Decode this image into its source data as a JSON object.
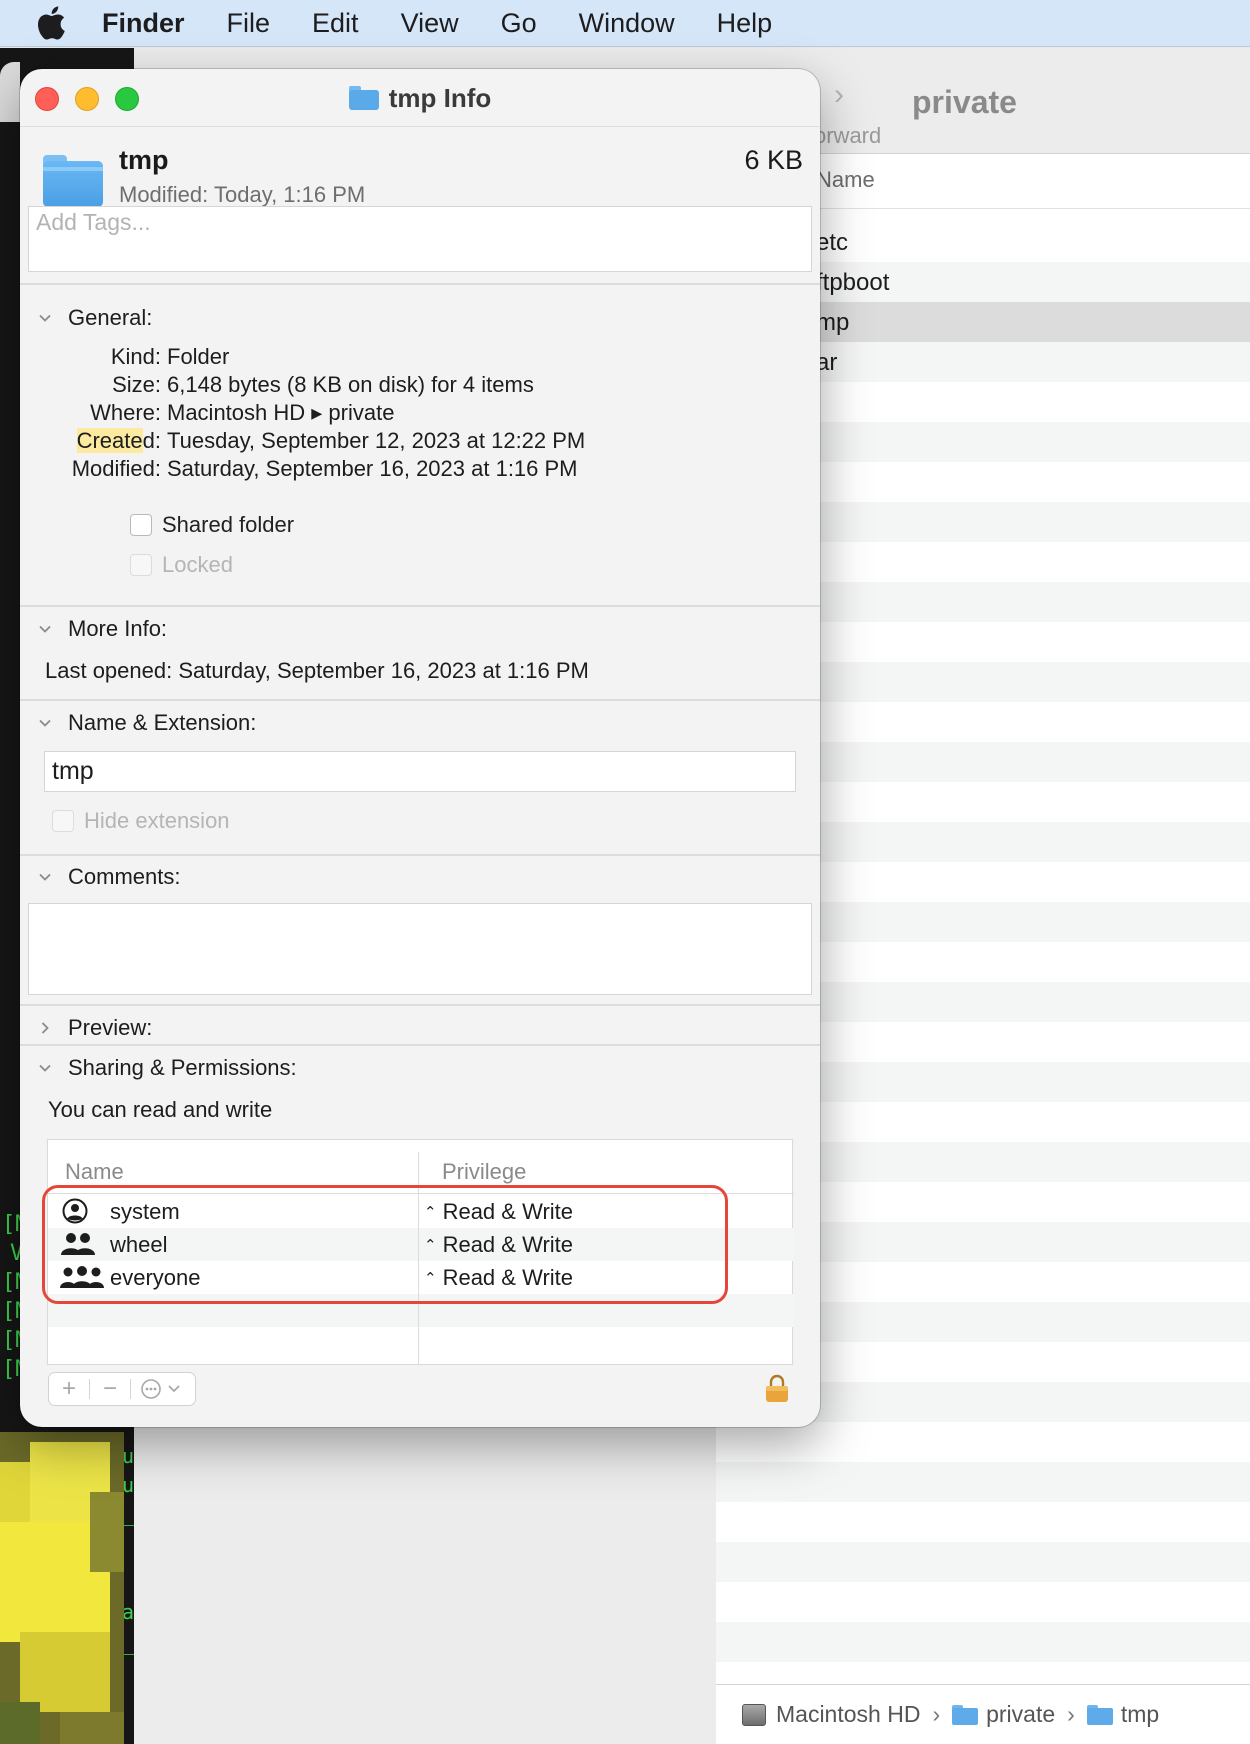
{
  "menubar": {
    "app_name": "Finder",
    "items": [
      "File",
      "Edit",
      "View",
      "Go",
      "Window",
      "Help"
    ]
  },
  "terminal": {
    "lines": [
      "[M",
      "V",
      "[M",
      "[M",
      "[M",
      "[MacBook"
    ],
    "right_chars": [
      "u",
      "u",
      "u",
      "_",
      "a",
      "_"
    ]
  },
  "finder_window": {
    "title": "private",
    "forward_label": "orward",
    "column_header": "Name",
    "rows": [
      "etc",
      "ftpboot",
      "mp",
      "ar"
    ],
    "selected_index": 2,
    "pathbar": [
      "Macintosh HD",
      "private",
      "tmp"
    ]
  },
  "info_window": {
    "title": "tmp Info",
    "name": "tmp",
    "size": "6 KB",
    "modified_label": "Modified:",
    "modified_value": "Today, 1:16 PM",
    "tags_placeholder": "Add Tags...",
    "general": {
      "heading": "General:",
      "rows": [
        {
          "key": "Kind:",
          "value": "Folder"
        },
        {
          "key": "Size:",
          "value": "6,148 bytes (8 KB on disk) for 4 items"
        },
        {
          "key": "Where:",
          "value": "Macintosh HD ▸ private"
        },
        {
          "key_highlight": "Create",
          "key_rest": "d:",
          "value": "Tuesday, September 12, 2023 at 12:22 PM"
        },
        {
          "key": "Modified:",
          "value": "Saturday, September 16, 2023 at 1:16 PM"
        }
      ],
      "shared_folder": "Shared folder",
      "locked": "Locked"
    },
    "more_info": {
      "heading": "More Info:",
      "last_opened": "Last opened: Saturday, September 16, 2023 at 1:16 PM"
    },
    "name_extension": {
      "heading": "Name & Extension:",
      "value": "tmp",
      "hide_extension": "Hide extension"
    },
    "comments": {
      "heading": "Comments:"
    },
    "preview": {
      "heading": "Preview:"
    },
    "sharing": {
      "heading": "Sharing & Permissions:",
      "access": "You can read and write",
      "columns": [
        "Name",
        "Privilege"
      ],
      "rows": [
        {
          "name": "system",
          "icon": "user-icon",
          "privilege": "Read & Write"
        },
        {
          "name": "wheel",
          "icon": "group-icon",
          "privilege": "Read & Write"
        },
        {
          "name": "everyone",
          "icon": "everyone-icon",
          "privilege": "Read & Write"
        }
      ]
    },
    "controls": {
      "add": "+",
      "remove": "−"
    }
  },
  "colors": {
    "menubar_bg": "#d5e6f8",
    "highlight_ring": "#e6463a",
    "folder_blue": "#5aa9e8",
    "terminal_green": "#3bd14b"
  }
}
